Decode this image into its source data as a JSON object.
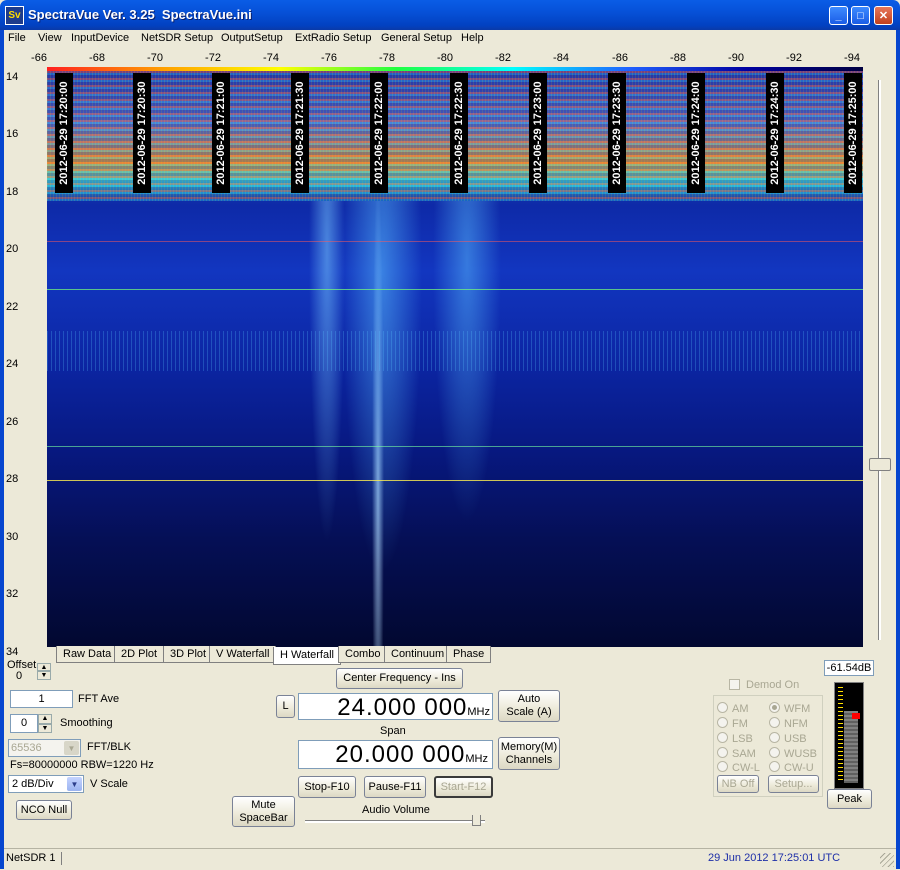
{
  "window": {
    "title": "SpectraVue Ver. 3.25  SpectraVue.ini",
    "icon_text": "Sv",
    "minimize": "_",
    "maximize": "□",
    "close": "✕"
  },
  "menu": [
    "File",
    "View",
    "InputDevice",
    "NetSDR Setup",
    "OutputSetup",
    "ExtRadio Setup",
    "General Setup",
    "Help"
  ],
  "x_axis": [
    "-66",
    "-68",
    "-70",
    "-72",
    "-74",
    "-76",
    "-78",
    "-80",
    "-82",
    "-84",
    "-86",
    "-88",
    "-90",
    "-92",
    "-94"
  ],
  "y_axis": [
    "14",
    "16",
    "18",
    "20",
    "22",
    "24",
    "26",
    "28",
    "30",
    "32",
    "34"
  ],
  "timestamps": [
    "2012-06-29 17:20:00",
    "2012-06-29 17:20:30",
    "2012-06-29 17:21:00",
    "2012-06-29 17:21:30",
    "2012-06-29 17:22:00",
    "2012-06-29 17:22:30",
    "2012-06-29 17:23:00",
    "2012-06-29 17:23:30",
    "2012-06-29 17:24:00",
    "2012-06-29 17:24:30",
    "2012-06-29 17:25:00"
  ],
  "tabs": [
    {
      "label": "Raw Data",
      "active": false
    },
    {
      "label": "2D Plot",
      "active": false
    },
    {
      "label": "3D Plot",
      "active": false
    },
    {
      "label": "V Waterfall",
      "active": false
    },
    {
      "label": "H Waterfall",
      "active": true
    },
    {
      "label": "Combo",
      "active": false
    },
    {
      "label": "Continuum",
      "active": false
    },
    {
      "label": "Phase",
      "active": false
    }
  ],
  "controls": {
    "offset_label": "Offset",
    "offset_value": "0",
    "fft_ave_value": "1",
    "fft_ave_label": "FFT Ave",
    "smoothing_value": "0",
    "smoothing_label": "Smoothing",
    "fft_blk_value": "65536",
    "fft_blk_label": "FFT/BLK",
    "fs_info": "Fs=80000000 RBW=1220 Hz",
    "vscale_value": "2 dB/Div",
    "vscale_label": "V Scale",
    "nco_null": "NCO Null",
    "mute": "Mute SpaceBar",
    "center_freq_button": "Center Frequency - Ins",
    "l_button": "L",
    "center_freq_value": "24.000 000",
    "center_freq_unit": "MHz",
    "auto_scale": "Auto Scale (A)",
    "span_label": "Span",
    "span_value": "20.000 000",
    "span_unit": "MHz",
    "memory": "Memory(M) Channels",
    "stop": "Stop-F10",
    "pause": "Pause-F11",
    "start": "Start-F12",
    "audio_volume": "Audio Volume",
    "audio_volume_level": 0.95
  },
  "demod": {
    "checkbox_label": "Demod On",
    "modes": [
      {
        "label": "AM",
        "selected": false
      },
      {
        "label": "WFM",
        "selected": true
      },
      {
        "label": "FM",
        "selected": false
      },
      {
        "label": "NFM",
        "selected": false
      },
      {
        "label": "LSB",
        "selected": false
      },
      {
        "label": "USB",
        "selected": false
      },
      {
        "label": "SAM",
        "selected": false
      },
      {
        "label": "WUSB",
        "selected": false
      },
      {
        "label": "CW-L",
        "selected": false
      },
      {
        "label": "CW-U",
        "selected": false
      }
    ],
    "nb_off": "NB Off",
    "setup": "Setup..."
  },
  "meter": {
    "readout": "-61.54dB",
    "peak": "Peak"
  },
  "status": {
    "left": "NetSDR 1",
    "right": "29 Jun 2012  17:25:01 UTC"
  },
  "colors": {
    "title_blue": "#0651d8",
    "date_blue": "#1e2fa8",
    "meter_red": "#ff0000"
  }
}
